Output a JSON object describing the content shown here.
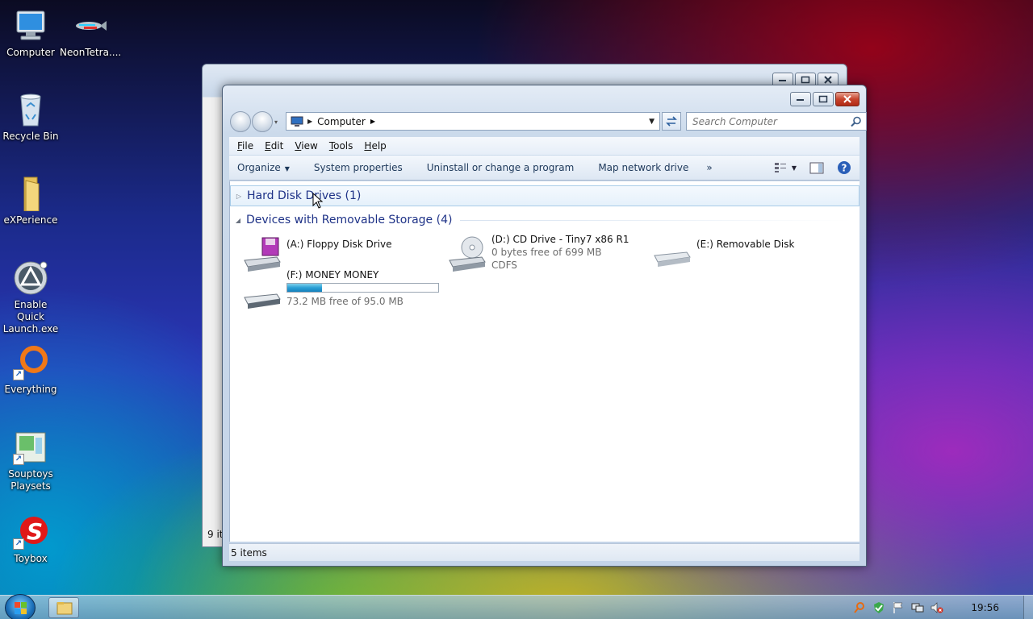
{
  "desktop": {
    "icons": [
      {
        "label": "Computer",
        "icon": "computer-icon"
      },
      {
        "label": "NeonTetra....",
        "icon": "fish-icon"
      },
      {
        "label": "Recycle Bin",
        "icon": "recycle-bin-icon"
      },
      {
        "label": "eXPerience",
        "icon": "folder-icon"
      },
      {
        "label": "Enable Quick Launch.exe",
        "icon": "quick-launch-icon"
      },
      {
        "label": "Everything",
        "icon": "everything-icon"
      },
      {
        "label": "Souptoys Playsets",
        "icon": "souptoys-icon"
      },
      {
        "label": "Toybox",
        "icon": "toybox-icon"
      }
    ]
  },
  "background_window": {
    "status": "9 it"
  },
  "explorer": {
    "address": {
      "crumb": "Computer"
    },
    "search": {
      "placeholder": "Search Computer"
    },
    "menu": [
      "File",
      "Edit",
      "View",
      "Tools",
      "Help"
    ],
    "toolbar": {
      "organize": "Organize",
      "system_properties": "System properties",
      "uninstall": "Uninstall or change a program",
      "map_drive": "Map network drive",
      "more": "»"
    },
    "groups": {
      "hard_disk": "Hard Disk Drives (1)",
      "removable": "Devices with Removable Storage (4)"
    },
    "drives": {
      "floppy": {
        "name": "(A:) Floppy Disk Drive"
      },
      "cd": {
        "name": "(D:) CD Drive - Tiny7 x86 R1",
        "free": "0 bytes free of 699 MB",
        "fs": "CDFS"
      },
      "removable": {
        "name": "(E:) Removable Disk"
      },
      "money": {
        "name": "(F:) MONEY MONEY",
        "free": "73.2 MB free of 95.0 MB",
        "used_fraction": 0.23
      }
    },
    "status": "5 items"
  },
  "taskbar": {
    "clock": "19:56"
  },
  "colors": {
    "accent": "#1e3287",
    "close": "#c7452e"
  }
}
